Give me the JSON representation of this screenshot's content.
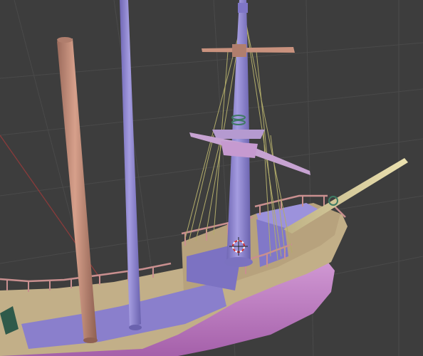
{
  "app": {
    "view": "3D Viewport",
    "scene_subject": "ship-model"
  },
  "colors": {
    "background": "#3d3d3d",
    "grid_line": "#4a4a4a",
    "grid_axis_red": "#8a3b3b",
    "mast_purple": "#8c83cf",
    "mast_tan": "#c48c78",
    "deck": "#8a7fcc",
    "hull_tan": "#c2af88",
    "hull_pink": "#c47fc6",
    "rail_pink": "#c98f8f",
    "yard_pink": "#c7a3d2",
    "rope": "#b2ac6a",
    "bowsprit": "#d9cf9a",
    "cursor_red": "#d23030"
  },
  "icons": [
    "3d-cursor-icon"
  ]
}
